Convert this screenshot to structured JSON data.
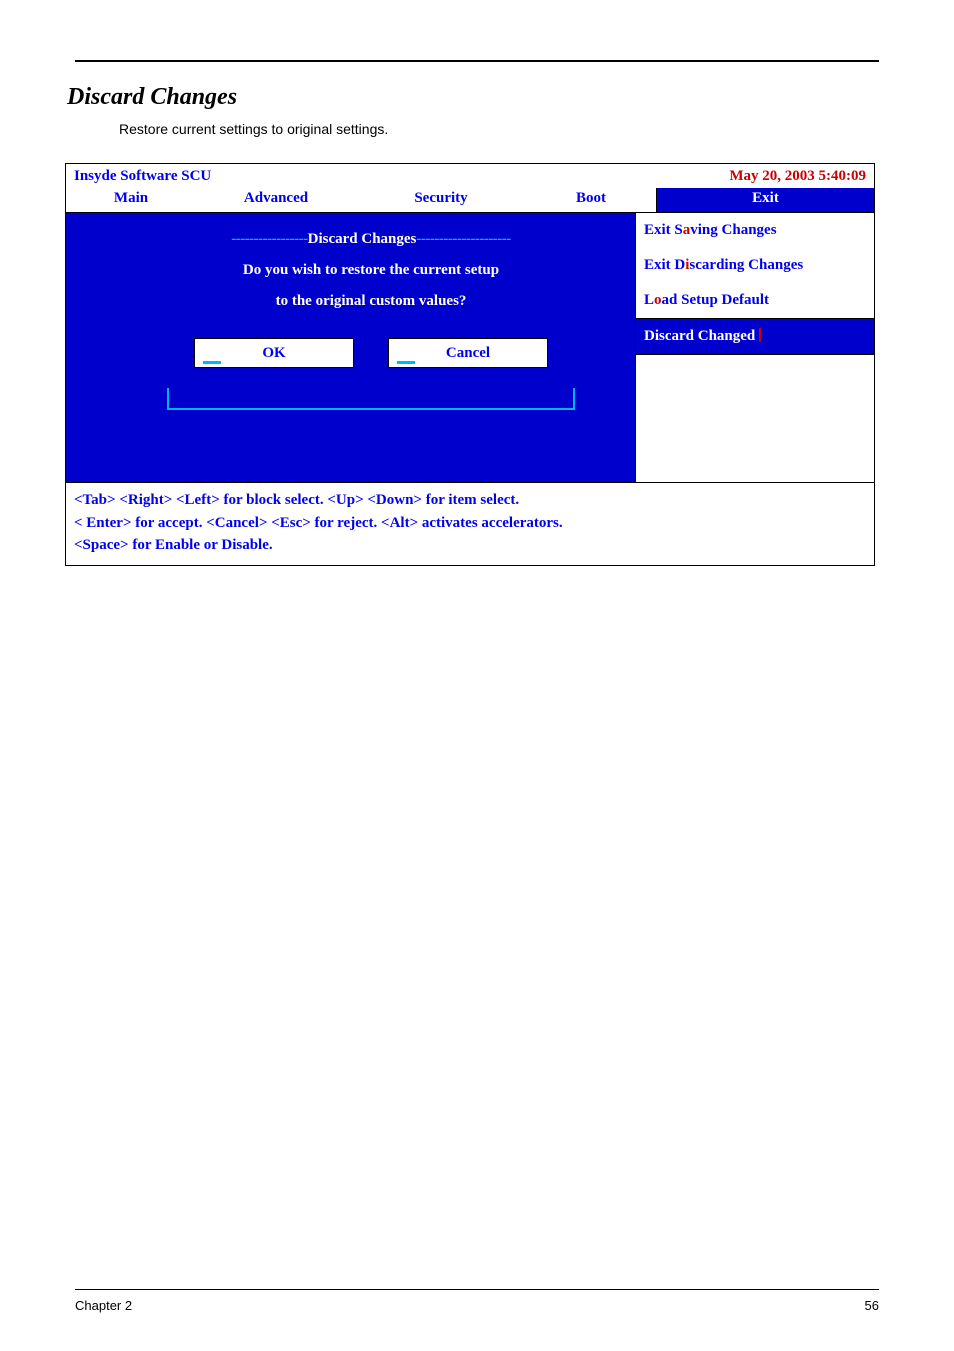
{
  "section": {
    "title": "Discard Changes",
    "description": "Restore current settings to original settings."
  },
  "bios": {
    "product": "Insyde Software SCU",
    "datetime": "May 20, 2003 5:40:09",
    "tabs": {
      "main": "Main",
      "advanced": "Advanced",
      "security": "Security",
      "boot": "Boot",
      "exit": "Exit"
    },
    "dialog": {
      "dashes_left": "-----------------",
      "title": "Discard Changes",
      "dashes_right": "---------------------",
      "line1": "Do you wish to restore the current setup",
      "line2": "to the original custom values?",
      "ok": "OK",
      "cancel": "Cancel"
    },
    "exit_menu": {
      "saving_pre": "Exit S",
      "saving_hot": "a",
      "saving_post": "ving Changes",
      "discarding_pre": "Exit D",
      "discarding_hot": "i",
      "discarding_post": "scarding Changes",
      "load_pre": "L",
      "load_hot": "o",
      "load_post": "ad Setup Default",
      "discard_changed": "Discard Changed"
    },
    "help": {
      "l1": "<Tab> <Right> <Left> for block select.    <Up> <Down> for item select.",
      "l2": "< Enter> for accept. <Cancel> <Esc> for reject. <Alt> activates accelerators.",
      "l3": "<Space> for Enable or Disable."
    }
  },
  "footer": {
    "chapter": "Chapter 2",
    "page": "56"
  }
}
